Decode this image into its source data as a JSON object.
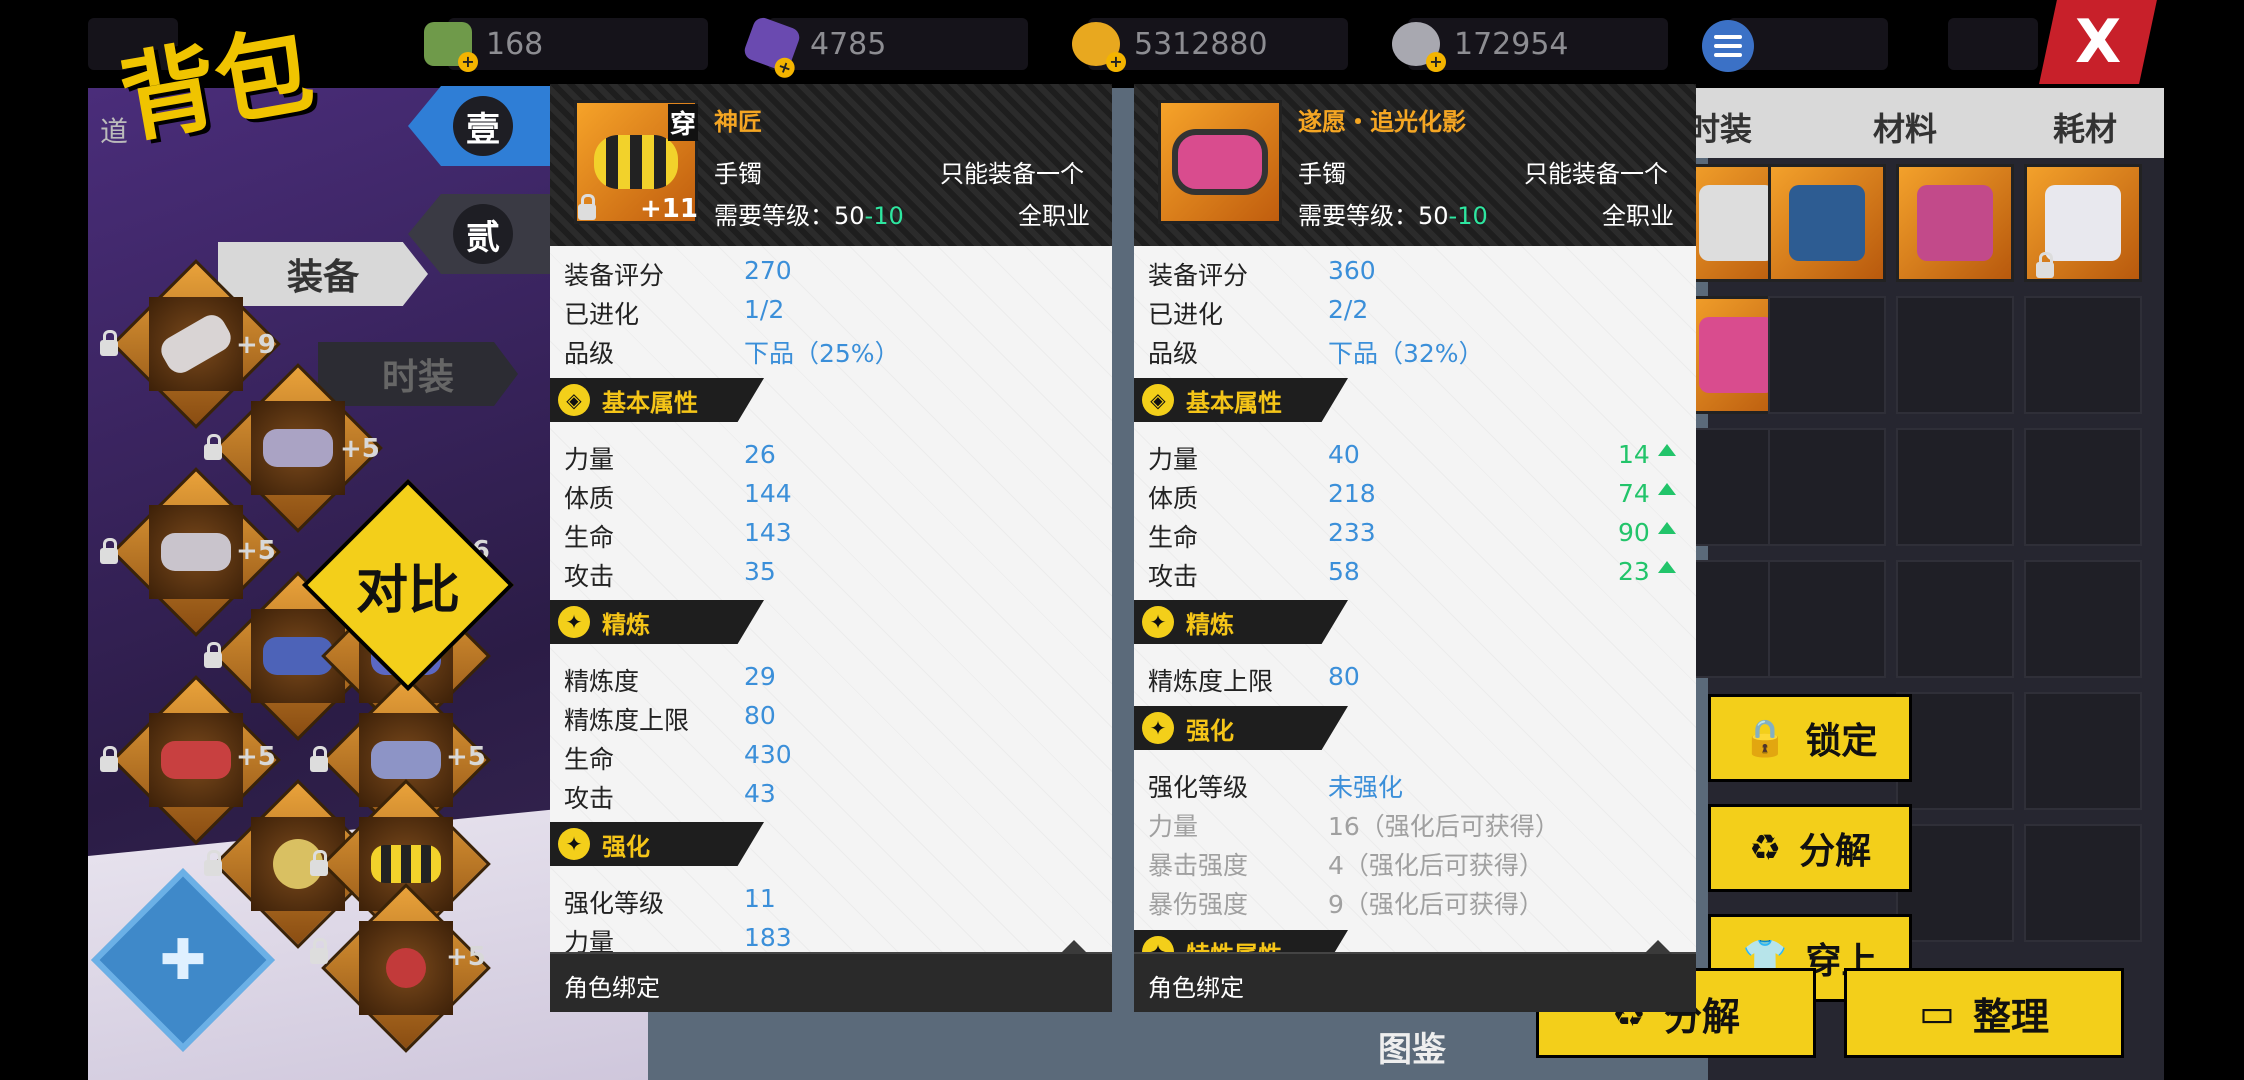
{
  "title": "背包",
  "currencies": [
    {
      "icon": "cash-icon",
      "value": "168"
    },
    {
      "icon": "crystal-icon",
      "value": "4785"
    },
    {
      "icon": "gold-coin-icon",
      "value": "5312880"
    },
    {
      "icon": "silver-coin-icon",
      "value": "172954"
    }
  ],
  "close_label": "X",
  "side_tabs": {
    "one": "壹",
    "two": "贰",
    "equip": "装备",
    "fashion": "时装",
    "side_char": "道"
  },
  "compare_label": "对比",
  "inventory_levels": [
    "+9",
    "+5",
    "+5",
    "+6",
    "+6",
    "+5",
    "+5",
    "+5",
    "+5"
  ],
  "left_panel": {
    "name": "神匠",
    "equipped_badge": "穿",
    "enhance_level": "+11",
    "type": "手镯",
    "limit": "只能装备一个",
    "req_prefix": "需要等级：",
    "req_low": "50",
    "req_sep": "-",
    "req_high": "10",
    "job": "全职业",
    "score_k": "装备评分",
    "score_v": "270",
    "evo_k": "已进化",
    "evo_v": "1/2",
    "grade_k": "品级",
    "grade_v": "下品（25%）",
    "sec_basic": "基本属性",
    "basic": [
      {
        "k": "力量",
        "v": "26"
      },
      {
        "k": "体质",
        "v": "144"
      },
      {
        "k": "生命",
        "v": "143"
      },
      {
        "k": "攻击",
        "v": "35"
      }
    ],
    "sec_refine": "精炼",
    "refine": [
      {
        "k": "精炼度",
        "v": "29"
      },
      {
        "k": "精炼度上限",
        "v": "80"
      },
      {
        "k": "生命",
        "v": "430"
      },
      {
        "k": "攻击",
        "v": "43"
      }
    ],
    "sec_enhance": "强化",
    "enhance": [
      {
        "k": "强化等级",
        "v": "11"
      },
      {
        "k": "力量",
        "v": "183"
      }
    ],
    "footer": "角色绑定"
  },
  "right_panel": {
    "name": "遂愿・追光化影",
    "type": "手镯",
    "limit": "只能装备一个",
    "req_prefix": "需要等级：",
    "req_low": "50",
    "req_sep": "-",
    "req_high": "10",
    "job": "全职业",
    "score_k": "装备评分",
    "score_v": "360",
    "evo_k": "已进化",
    "evo_v": "2/2",
    "grade_k": "品级",
    "grade_v": "下品（32%）",
    "sec_basic": "基本属性",
    "basic": [
      {
        "k": "力量",
        "v": "40",
        "diff": "14"
      },
      {
        "k": "体质",
        "v": "218",
        "diff": "74"
      },
      {
        "k": "生命",
        "v": "233",
        "diff": "90"
      },
      {
        "k": "攻击",
        "v": "58",
        "diff": "23"
      }
    ],
    "sec_refine": "精炼",
    "refine": [
      {
        "k": "精炼度上限",
        "v": "80"
      }
    ],
    "sec_enhance": "强化",
    "enhance": [
      {
        "k": "强化等级",
        "v": "未强化"
      },
      {
        "k": "力量",
        "v": "16（强化后可获得）"
      },
      {
        "k": "暴击强度",
        "v": "4（强化后可获得）"
      },
      {
        "k": "暴伤强度",
        "v": "9（强化后可获得）"
      }
    ],
    "sec_trait": "特性属性",
    "footer": "角色绑定"
  },
  "inv_tabs": [
    "时装",
    "材料",
    "耗材"
  ],
  "actions": {
    "lock": "锁定",
    "decompose": "分解",
    "wear": "穿上"
  },
  "bottom": {
    "decompose": "分解",
    "sort": "整理",
    "atlas": "图鉴"
  }
}
